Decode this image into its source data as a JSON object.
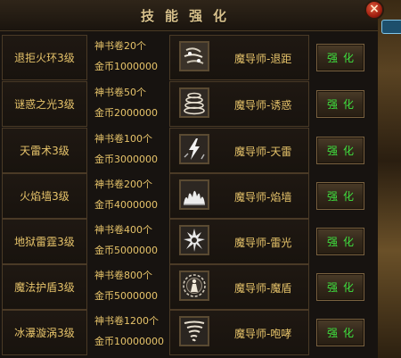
{
  "window": {
    "title": "技能强化",
    "close_label": "×"
  },
  "skills": [
    {
      "name": "退拒火环3级",
      "cost1": "神书卷20个",
      "cost2": "金币1000000",
      "result": "魔导师-退距",
      "icon": "wind-swirl-icon",
      "button": "强化"
    },
    {
      "name": "谜惑之光3级",
      "cost1": "神书卷50个",
      "cost2": "金币2000000",
      "result": "魔导师-诱惑",
      "icon": "stacked-rings-icon",
      "button": "强化"
    },
    {
      "name": "天雷术3级",
      "cost1": "神书卷100个",
      "cost2": "金币3000000",
      "result": "魔导师-天雷",
      "icon": "lightning-icon",
      "button": "强化"
    },
    {
      "name": "火焰墙3级",
      "cost1": "神书卷200个",
      "cost2": "金币4000000",
      "result": "魔导师-焰墙",
      "icon": "flame-wall-icon",
      "button": "强化"
    },
    {
      "name": "地狱雷霆3级",
      "cost1": "神书卷400个",
      "cost2": "金币5000000",
      "result": "魔导师-雷光",
      "icon": "thunder-burst-icon",
      "button": "强化"
    },
    {
      "name": "魔法护盾3级",
      "cost1": "神书卷800个",
      "cost2": "金币5000000",
      "result": "魔导师-魔盾",
      "icon": "shield-figure-icon",
      "button": "强化"
    },
    {
      "name": "冰瀑漩涡3级",
      "cost1": "神书卷1200个",
      "cost2": "金币10000000",
      "result": "魔导师-咆哮",
      "icon": "tornado-icon",
      "button": "强化"
    }
  ]
}
